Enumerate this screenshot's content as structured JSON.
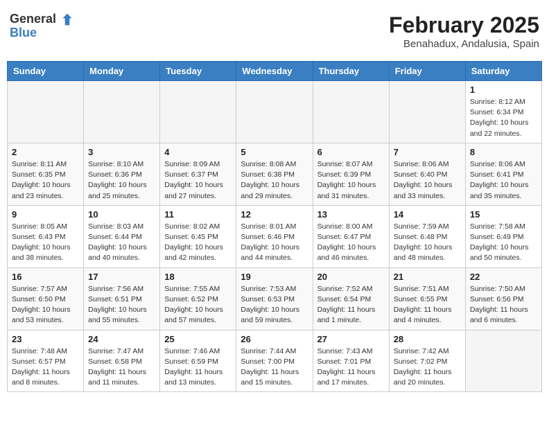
{
  "header": {
    "logo_general": "General",
    "logo_blue": "Blue",
    "title": "February 2025",
    "subtitle": "Benahadux, Andalusia, Spain"
  },
  "weekdays": [
    "Sunday",
    "Monday",
    "Tuesday",
    "Wednesday",
    "Thursday",
    "Friday",
    "Saturday"
  ],
  "weeks": [
    [
      {
        "day": "",
        "info": ""
      },
      {
        "day": "",
        "info": ""
      },
      {
        "day": "",
        "info": ""
      },
      {
        "day": "",
        "info": ""
      },
      {
        "day": "",
        "info": ""
      },
      {
        "day": "",
        "info": ""
      },
      {
        "day": "1",
        "info": "Sunrise: 8:12 AM\nSunset: 6:34 PM\nDaylight: 10 hours\nand 22 minutes."
      }
    ],
    [
      {
        "day": "2",
        "info": "Sunrise: 8:11 AM\nSunset: 6:35 PM\nDaylight: 10 hours\nand 23 minutes."
      },
      {
        "day": "3",
        "info": "Sunrise: 8:10 AM\nSunset: 6:36 PM\nDaylight: 10 hours\nand 25 minutes."
      },
      {
        "day": "4",
        "info": "Sunrise: 8:09 AM\nSunset: 6:37 PM\nDaylight: 10 hours\nand 27 minutes."
      },
      {
        "day": "5",
        "info": "Sunrise: 8:08 AM\nSunset: 6:38 PM\nDaylight: 10 hours\nand 29 minutes."
      },
      {
        "day": "6",
        "info": "Sunrise: 8:07 AM\nSunset: 6:39 PM\nDaylight: 10 hours\nand 31 minutes."
      },
      {
        "day": "7",
        "info": "Sunrise: 8:06 AM\nSunset: 6:40 PM\nDaylight: 10 hours\nand 33 minutes."
      },
      {
        "day": "8",
        "info": "Sunrise: 8:06 AM\nSunset: 6:41 PM\nDaylight: 10 hours\nand 35 minutes."
      }
    ],
    [
      {
        "day": "9",
        "info": "Sunrise: 8:05 AM\nSunset: 6:43 PM\nDaylight: 10 hours\nand 38 minutes."
      },
      {
        "day": "10",
        "info": "Sunrise: 8:03 AM\nSunset: 6:44 PM\nDaylight: 10 hours\nand 40 minutes."
      },
      {
        "day": "11",
        "info": "Sunrise: 8:02 AM\nSunset: 6:45 PM\nDaylight: 10 hours\nand 42 minutes."
      },
      {
        "day": "12",
        "info": "Sunrise: 8:01 AM\nSunset: 6:46 PM\nDaylight: 10 hours\nand 44 minutes."
      },
      {
        "day": "13",
        "info": "Sunrise: 8:00 AM\nSunset: 6:47 PM\nDaylight: 10 hours\nand 46 minutes."
      },
      {
        "day": "14",
        "info": "Sunrise: 7:59 AM\nSunset: 6:48 PM\nDaylight: 10 hours\nand 48 minutes."
      },
      {
        "day": "15",
        "info": "Sunrise: 7:58 AM\nSunset: 6:49 PM\nDaylight: 10 hours\nand 50 minutes."
      }
    ],
    [
      {
        "day": "16",
        "info": "Sunrise: 7:57 AM\nSunset: 6:50 PM\nDaylight: 10 hours\nand 53 minutes."
      },
      {
        "day": "17",
        "info": "Sunrise: 7:56 AM\nSunset: 6:51 PM\nDaylight: 10 hours\nand 55 minutes."
      },
      {
        "day": "18",
        "info": "Sunrise: 7:55 AM\nSunset: 6:52 PM\nDaylight: 10 hours\nand 57 minutes."
      },
      {
        "day": "19",
        "info": "Sunrise: 7:53 AM\nSunset: 6:53 PM\nDaylight: 10 hours\nand 59 minutes."
      },
      {
        "day": "20",
        "info": "Sunrise: 7:52 AM\nSunset: 6:54 PM\nDaylight: 11 hours\nand 1 minute."
      },
      {
        "day": "21",
        "info": "Sunrise: 7:51 AM\nSunset: 6:55 PM\nDaylight: 11 hours\nand 4 minutes."
      },
      {
        "day": "22",
        "info": "Sunrise: 7:50 AM\nSunset: 6:56 PM\nDaylight: 11 hours\nand 6 minutes."
      }
    ],
    [
      {
        "day": "23",
        "info": "Sunrise: 7:48 AM\nSunset: 6:57 PM\nDaylight: 11 hours\nand 8 minutes."
      },
      {
        "day": "24",
        "info": "Sunrise: 7:47 AM\nSunset: 6:58 PM\nDaylight: 11 hours\nand 11 minutes."
      },
      {
        "day": "25",
        "info": "Sunrise: 7:46 AM\nSunset: 6:59 PM\nDaylight: 11 hours\nand 13 minutes."
      },
      {
        "day": "26",
        "info": "Sunrise: 7:44 AM\nSunset: 7:00 PM\nDaylight: 11 hours\nand 15 minutes."
      },
      {
        "day": "27",
        "info": "Sunrise: 7:43 AM\nSunset: 7:01 PM\nDaylight: 11 hours\nand 17 minutes."
      },
      {
        "day": "28",
        "info": "Sunrise: 7:42 AM\nSunset: 7:02 PM\nDaylight: 11 hours\nand 20 minutes."
      },
      {
        "day": "",
        "info": ""
      }
    ]
  ]
}
